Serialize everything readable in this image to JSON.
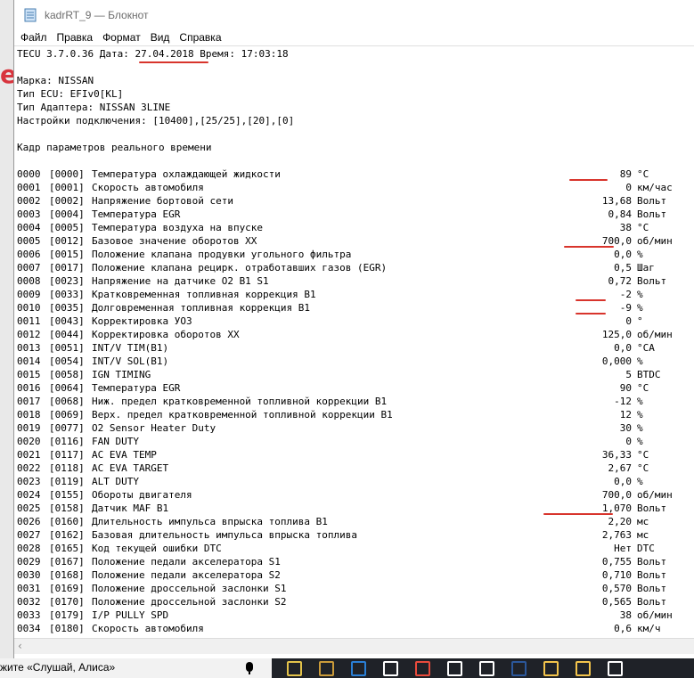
{
  "window": {
    "title": "kadrRT_9 — Блокнот"
  },
  "menu": [
    {
      "label": "Файл"
    },
    {
      "label": "Правка"
    },
    {
      "label": "Формат"
    },
    {
      "label": "Вид"
    },
    {
      "label": "Справка"
    }
  ],
  "header_lines": [
    "TECU 3.7.0.36 Дата: 27.04.2018 Время: 17:03:18",
    "",
    "Марка: NISSAN",
    "Тип ECU: EFIv0[KL]",
    "Тип Адаптера: NISSAN 3LINE",
    "Настройки подключения: [10400],[25/25],[20],[0]",
    "",
    "Кадр параметров реального времени",
    ""
  ],
  "params": [
    {
      "idx": "0000",
      "code": "[0000]",
      "name": "Температура охлаждающей жидкости",
      "value": "89",
      "unit": "°C"
    },
    {
      "idx": "0001",
      "code": "[0001]",
      "name": "Скорость автомобиля",
      "value": "0",
      "unit": "км/час"
    },
    {
      "idx": "0002",
      "code": "[0002]",
      "name": "Напряжение бортовой сети",
      "value": "13,68",
      "unit": "Вольт"
    },
    {
      "idx": "0003",
      "code": "[0004]",
      "name": "Температура EGR",
      "value": "0,84",
      "unit": "Вольт"
    },
    {
      "idx": "0004",
      "code": "[0005]",
      "name": "Температура воздуха на впуске",
      "value": "38",
      "unit": "°C"
    },
    {
      "idx": "0005",
      "code": "[0012]",
      "name": "Базовое значение оборотов ХХ",
      "value": "700,0",
      "unit": "об/мин"
    },
    {
      "idx": "0006",
      "code": "[0015]",
      "name": "Положение клапана продувки угольного фильтра",
      "value": "0,0",
      "unit": "%"
    },
    {
      "idx": "0007",
      "code": "[0017]",
      "name": "Положение клапана рецирк. отработавших газов (EGR)",
      "value": "0,5",
      "unit": "Шаг"
    },
    {
      "idx": "0008",
      "code": "[0023]",
      "name": "Напряжение на датчике O2 B1 S1",
      "value": "0,72",
      "unit": "Вольт"
    },
    {
      "idx": "0009",
      "code": "[0033]",
      "name": "Кратковременная топливная коррекция B1",
      "value": "-2",
      "unit": "%"
    },
    {
      "idx": "0010",
      "code": "[0035]",
      "name": "Долговременная топливная коррекция B1",
      "value": "-9",
      "unit": "%"
    },
    {
      "idx": "0011",
      "code": "[0043]",
      "name": "Корректировка УОЗ",
      "value": "0",
      "unit": "°"
    },
    {
      "idx": "0012",
      "code": "[0044]",
      "name": "Корректировка оборотов ХХ",
      "value": "125,0",
      "unit": "об/мин"
    },
    {
      "idx": "0013",
      "code": "[0051]",
      "name": "INT/V TIM(B1)",
      "value": "0,0",
      "unit": "°CA"
    },
    {
      "idx": "0014",
      "code": "[0054]",
      "name": "INT/V SOL(B1)",
      "value": "0,000",
      "unit": "%"
    },
    {
      "idx": "0015",
      "code": "[0058]",
      "name": "IGN TIMING",
      "value": "5",
      "unit": "BTDC"
    },
    {
      "idx": "0016",
      "code": "[0064]",
      "name": "Температура EGR",
      "value": "90",
      "unit": "°C"
    },
    {
      "idx": "0017",
      "code": "[0068]",
      "name": "Ниж. предел кратковременной топливной коррекции B1",
      "value": "-12",
      "unit": "%"
    },
    {
      "idx": "0018",
      "code": "[0069]",
      "name": "Верх. предел кратковременной топливной коррекции B1",
      "value": "12",
      "unit": "%"
    },
    {
      "idx": "0019",
      "code": "[0077]",
      "name": "O2 Sensor Heater Duty",
      "value": "30",
      "unit": "%"
    },
    {
      "idx": "0020",
      "code": "[0116]",
      "name": "FAN DUTY",
      "value": "0",
      "unit": "%"
    },
    {
      "idx": "0021",
      "code": "[0117]",
      "name": "AC EVA TEMP",
      "value": "36,33",
      "unit": "°C"
    },
    {
      "idx": "0022",
      "code": "[0118]",
      "name": "AC EVA TARGET",
      "value": "2,67",
      "unit": "°C"
    },
    {
      "idx": "0023",
      "code": "[0119]",
      "name": "ALT DUTY",
      "value": "0,0",
      "unit": "%"
    },
    {
      "idx": "0024",
      "code": "[0155]",
      "name": "Обороты двигателя",
      "value": "700,0",
      "unit": "об/мин"
    },
    {
      "idx": "0025",
      "code": "[0158]",
      "name": "Датчик MAF B1",
      "value": "1,070",
      "unit": "Вольт"
    },
    {
      "idx": "0026",
      "code": "[0160]",
      "name": "Длительность импульса впрыска топлива B1",
      "value": "2,20",
      "unit": "мс"
    },
    {
      "idx": "0027",
      "code": "[0162]",
      "name": "Базовая длительность импульса впрыска топлива",
      "value": "2,763",
      "unit": "мс"
    },
    {
      "idx": "0028",
      "code": "[0165]",
      "name": "Код текущей ошибки DTC",
      "value": "Нет",
      "unit": "DTC"
    },
    {
      "idx": "0029",
      "code": "[0167]",
      "name": "Положение педали акселератора S1",
      "value": "0,755",
      "unit": "Вольт"
    },
    {
      "idx": "0030",
      "code": "[0168]",
      "name": "Положение педали акселератора S2",
      "value": "0,710",
      "unit": "Вольт"
    },
    {
      "idx": "0031",
      "code": "[0169]",
      "name": "Положение дроссельной заслонки S1",
      "value": "0,570",
      "unit": "Вольт"
    },
    {
      "idx": "0032",
      "code": "[0170]",
      "name": "Положение дроссельной заслонки S2",
      "value": "0,565",
      "unit": "Вольт"
    },
    {
      "idx": "0033",
      "code": "[0179]",
      "name": "I/P PULLY SPD",
      "value": "38",
      "unit": "об/мин"
    },
    {
      "idx": "0034",
      "code": "[0180]",
      "name": "Скорость автомобиля",
      "value": "0,6",
      "unit": "км/ч"
    }
  ],
  "taskbar": {
    "search_text": "жите «Слушай, Алиса»",
    "icons": [
      "chrome-icon",
      "app-icon",
      "edge-icon",
      "mail-icon",
      "yandex-icon",
      "home-icon",
      "cart-icon",
      "word-icon",
      "folder-icon",
      "folder-icon",
      "store-icon"
    ]
  },
  "background": {
    "partial_letter": "e",
    "accent": "#d8343d"
  },
  "colors": {
    "annotation": "#d8342c",
    "taskbar": "#1f2228"
  }
}
